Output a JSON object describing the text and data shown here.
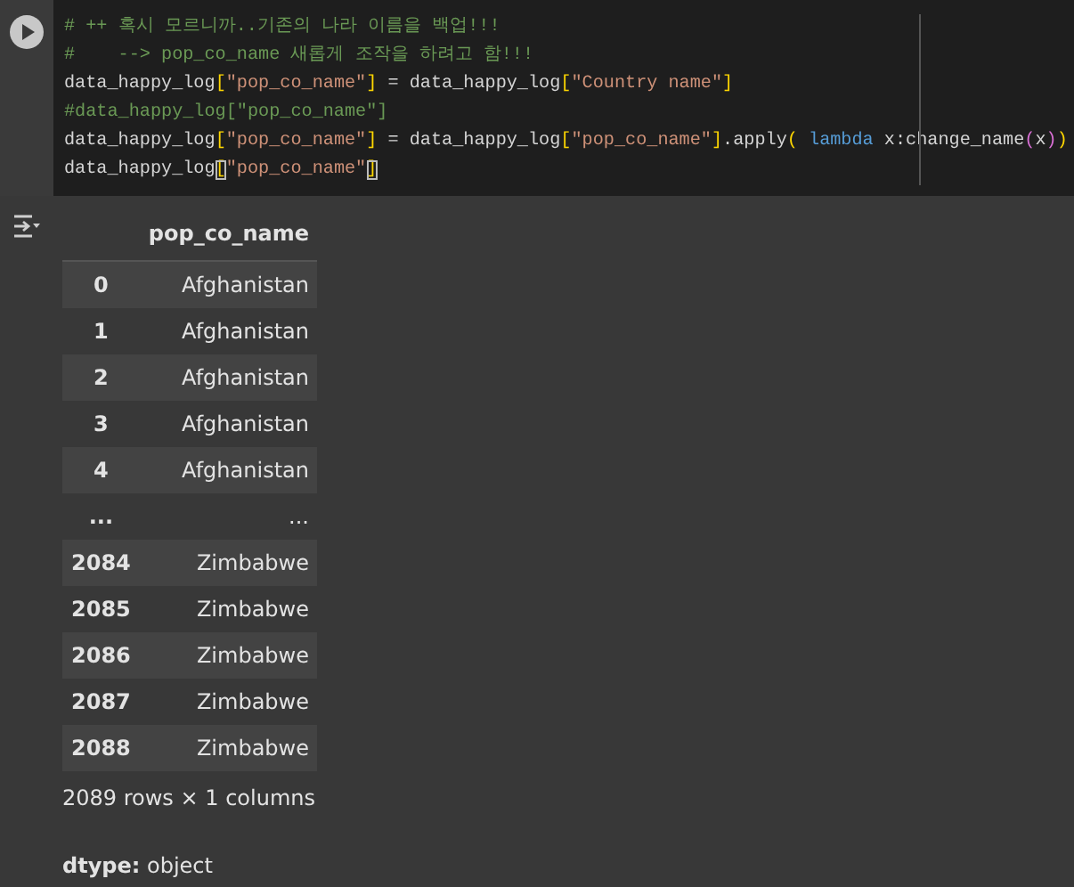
{
  "code_cell": {
    "lines": [
      [
        {
          "text": "# ++ 혹시 모르니까..기존의 나라 이름을 백업!!!",
          "kind": "comment"
        }
      ],
      [
        {
          "text": "#    --> pop_co_name 새롭게 조작을 하려고 함!!!",
          "kind": "comment"
        }
      ],
      [
        {
          "text": "data_happy_log",
          "kind": "plain"
        },
        {
          "text": "[",
          "kind": "bracket"
        },
        {
          "text": "\"pop_co_name\"",
          "kind": "string"
        },
        {
          "text": "]",
          "kind": "bracket"
        },
        {
          "text": " = data_happy_log",
          "kind": "plain"
        },
        {
          "text": "[",
          "kind": "bracket"
        },
        {
          "text": "\"Country name\"",
          "kind": "string"
        },
        {
          "text": "]",
          "kind": "bracket"
        }
      ],
      [
        {
          "text": "#data_happy_log[\"pop_co_name\"]",
          "kind": "comment"
        }
      ],
      [
        {
          "text": "data_happy_log",
          "kind": "plain"
        },
        {
          "text": "[",
          "kind": "bracket"
        },
        {
          "text": "\"pop_co_name\"",
          "kind": "string"
        },
        {
          "text": "]",
          "kind": "bracket"
        },
        {
          "text": " = data_happy_log",
          "kind": "plain"
        },
        {
          "text": "[",
          "kind": "bracket"
        },
        {
          "text": "\"pop_co_name\"",
          "kind": "string"
        },
        {
          "text": "]",
          "kind": "bracket"
        },
        {
          "text": ".apply",
          "kind": "plain"
        },
        {
          "text": "(",
          "kind": "bracket"
        },
        {
          "text": " lambda",
          "kind": "keyword"
        },
        {
          "text": " x:change_name",
          "kind": "plain"
        },
        {
          "text": "(",
          "kind": "paren"
        },
        {
          "text": "x",
          "kind": "plain"
        },
        {
          "text": ")",
          "kind": "paren"
        },
        {
          "text": ")",
          "kind": "bracket"
        }
      ],
      [
        {
          "text": "data_happy_log",
          "kind": "plain"
        },
        {
          "text": "[",
          "kind": "matched"
        },
        {
          "text": "\"pop_co_name\"",
          "kind": "string"
        },
        {
          "text": "]",
          "kind": "matched"
        }
      ]
    ]
  },
  "output": {
    "table": {
      "columns": [
        "pop_co_name"
      ],
      "rows": [
        {
          "index": "0",
          "value": "Afghanistan"
        },
        {
          "index": "1",
          "value": "Afghanistan"
        },
        {
          "index": "2",
          "value": "Afghanistan"
        },
        {
          "index": "3",
          "value": "Afghanistan"
        },
        {
          "index": "4",
          "value": "Afghanistan"
        },
        {
          "index": "...",
          "value": "..."
        },
        {
          "index": "2084",
          "value": "Zimbabwe"
        },
        {
          "index": "2085",
          "value": "Zimbabwe"
        },
        {
          "index": "2086",
          "value": "Zimbabwe"
        },
        {
          "index": "2087",
          "value": "Zimbabwe"
        },
        {
          "index": "2088",
          "value": "Zimbabwe"
        }
      ]
    },
    "shape": "2089 rows × 1 columns",
    "dtype": "**dtype:** object"
  }
}
